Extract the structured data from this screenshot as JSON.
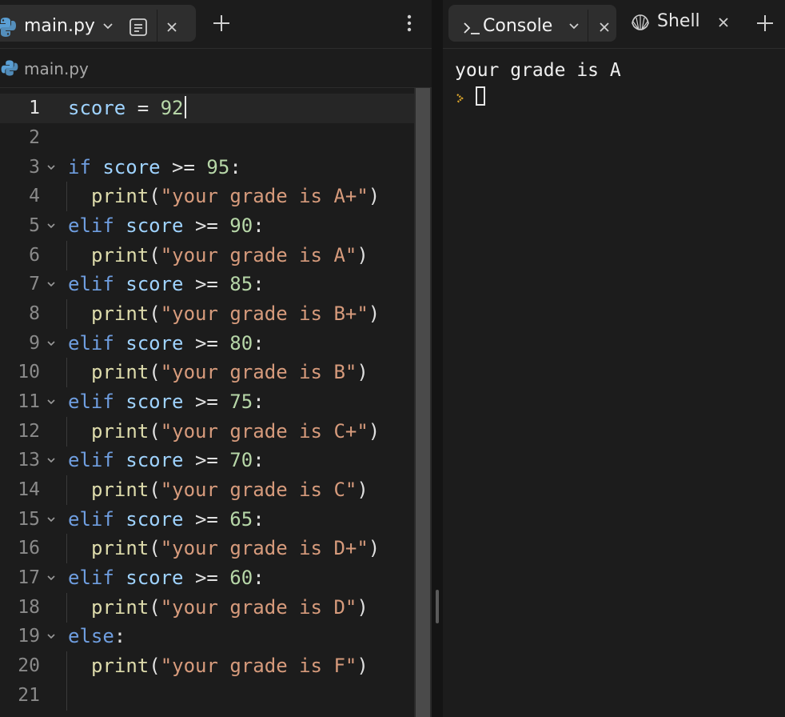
{
  "editor_tab": {
    "title": "main.py"
  },
  "breadcrumb": {
    "file": "main.py"
  },
  "console_tab": {
    "title": "Console"
  },
  "shell_tab": {
    "title": "Shell"
  },
  "console": {
    "output": "your grade is A"
  },
  "line_numbers": [
    "1",
    "2",
    "3",
    "4",
    "5",
    "6",
    "7",
    "8",
    "9",
    "10",
    "11",
    "12",
    "13",
    "14",
    "15",
    "16",
    "17",
    "18",
    "19",
    "20",
    "21"
  ],
  "code": {
    "l1": {
      "var": "score",
      "op": " = ",
      "num": "92"
    },
    "kw_if": "if",
    "kw_elif": "elif",
    "kw_else": "else",
    "var": "score",
    "ge": " >= ",
    "colon": ":",
    "fn": "print",
    "lp": "(",
    "rp": ")",
    "conditions": [
      "95",
      "90",
      "85",
      "80",
      "75",
      "70",
      "65",
      "60"
    ],
    "strings": [
      "\"your grade is A+\"",
      "\"your grade is A\"",
      "\"your grade is B+\"",
      "\"your grade is B\"",
      "\"your grade is C+\"",
      "\"your grade is C\"",
      "\"your grade is D+\"",
      "\"your grade is D\"",
      "\"your grade is F\""
    ]
  },
  "colors": {
    "keyword": "#6f9ee0",
    "variable": "#9fd3ff",
    "number": "#b7d7a8",
    "function": "#dedcac",
    "string": "#d79b7c",
    "prompt": "#d9a32a"
  }
}
